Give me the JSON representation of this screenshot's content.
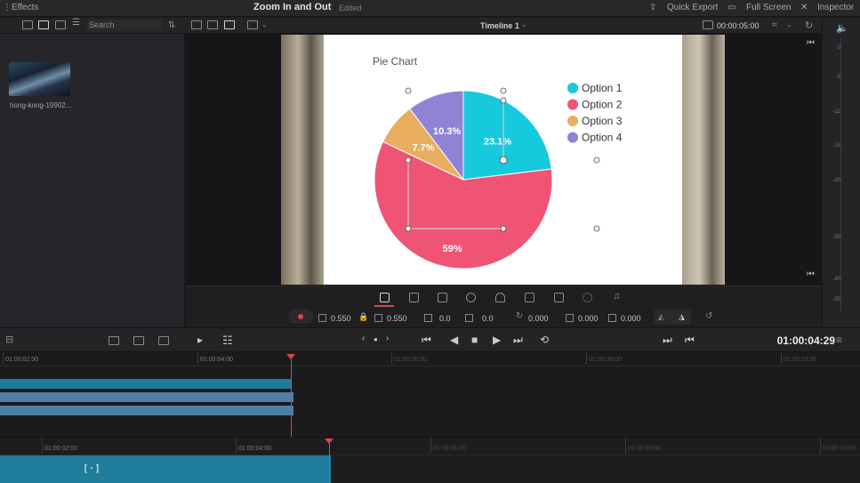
{
  "topbar": {
    "left_label": "Effects",
    "project_title": "Zoom In and Out",
    "status": "Edited",
    "quick_export": "Quick Export",
    "full_screen": "Full Screen",
    "inspector": "Inspector"
  },
  "toolbar": {
    "search_placeholder": "Search",
    "timeline_name": "Timeline 1",
    "viewer_timecode": "00:00:05:00"
  },
  "media": {
    "clip_name": "hong-kong-19902..."
  },
  "meter": {
    "ticks": [
      "0",
      "-5",
      "-12",
      "-15",
      "-20",
      "-30",
      "-40",
      "-50"
    ]
  },
  "transform": {
    "zoom_x": "0.550",
    "zoom_y": "0.550",
    "position_x": "0.0",
    "position_y": "0.0",
    "rotation": "0.000",
    "pitch": "0.000",
    "yaw": "0.000"
  },
  "transport": {
    "timecode": "01:00:04:29"
  },
  "timeline": {
    "upper_ruler": [
      "01:00:02:00",
      "01:00:04:00",
      "01:00:06:00",
      "01:00:08:00",
      "01:00:10:00"
    ],
    "lower_ruler": [
      "01:00:02:00",
      "01:00:04:00",
      "01:00:06:00",
      "01:00:08:00",
      "01:00:10:00"
    ],
    "lower_clip_label": "[·]"
  },
  "chart_data": {
    "type": "pie",
    "title": "Pie Chart",
    "series": [
      {
        "name": "Option 1",
        "value": 23.1,
        "label": "23.1%",
        "color": "#17c9dd"
      },
      {
        "name": "Option 2",
        "value": 59,
        "label": "59%",
        "color": "#ef5475"
      },
      {
        "name": "Option 3",
        "value": 7.7,
        "label": "7.7%",
        "color": "#e8ad5f"
      },
      {
        "name": "Option 4",
        "value": 10.3,
        "label": "10.3%",
        "color": "#8f83d6"
      }
    ],
    "legend_position": "right"
  },
  "colors": {
    "accent_red": "#e2434d",
    "clip_teal": "#1f7d9b",
    "clip_blue": "#4d7fa4"
  }
}
